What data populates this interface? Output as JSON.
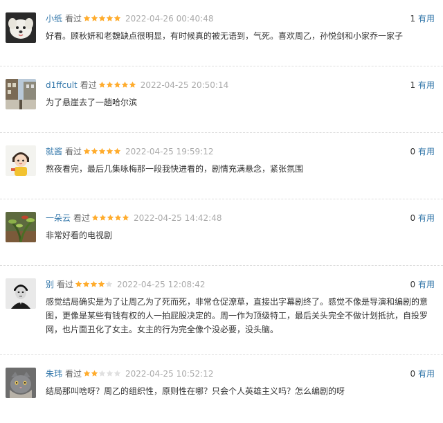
{
  "reviews": [
    {
      "user": "小纸",
      "seen_label": "看过",
      "rating": 5,
      "time": "2022-04-26 00:40:48",
      "votes": "1",
      "useful_label": "有用",
      "content": "好看。顾秋妍和老魏缺点很明显，有时候真的被无语到，气死。喜欢周乙，孙悦剑和小家乔一家子",
      "avatar": "white-dog-avatar"
    },
    {
      "user": "d1ffcult",
      "seen_label": "看过",
      "rating": 5,
      "time": "2022-04-25 20:50:14",
      "votes": "1",
      "useful_label": "有用",
      "content": "为了悬崖去了一趟哈尔滨",
      "avatar": "street-scene-avatar"
    },
    {
      "user": "就酱",
      "seen_label": "看过",
      "rating": 5,
      "time": "2022-04-25 19:59:12",
      "votes": "0",
      "useful_label": "有用",
      "content": "熬夜看完，最后几集咏梅那一段我快进看的，剧情充满悬念，紧张氛围",
      "avatar": "cartoon-girl-avatar"
    },
    {
      "user": "一朵云",
      "seen_label": "看过",
      "rating": 5,
      "time": "2022-04-25 14:42:48",
      "votes": "0",
      "useful_label": "有用",
      "content": "非常好看的电视剧",
      "avatar": "plant-avatar"
    },
    {
      "user": "别",
      "seen_label": "看过",
      "rating": 4,
      "time": "2022-04-25 12:08:42",
      "votes": "0",
      "useful_label": "有用",
      "content": "感觉结局确实是为了让周乙为了死而死，非常仓促潦草，直接出字幕剧终了。感觉不像是导演和编剧的意图，更像是某些有钱有权的人一拍屁股决定的。周一作为顶级特工，最后关头完全不做计划抵抗，自投罗网，也片面丑化了女主。女主的行为完全像个没必要，没头脑。",
      "avatar": "portrait-avatar"
    },
    {
      "user": "朱玮",
      "seen_label": "看过",
      "rating": 2,
      "time": "2022-04-25 10:52:12",
      "votes": "0",
      "useful_label": "有用",
      "content": "结局那叫啥呀？周乙的组织性，原则性在哪？只会个人英雄主义吗？怎么编剧的呀",
      "avatar": "gray-cat-avatar"
    }
  ],
  "colors": {
    "username": "#3377aa",
    "star_on": "#ffac2d",
    "star_off": "#e0e0e0",
    "time": "#aaaaaa",
    "text": "#333333"
  }
}
